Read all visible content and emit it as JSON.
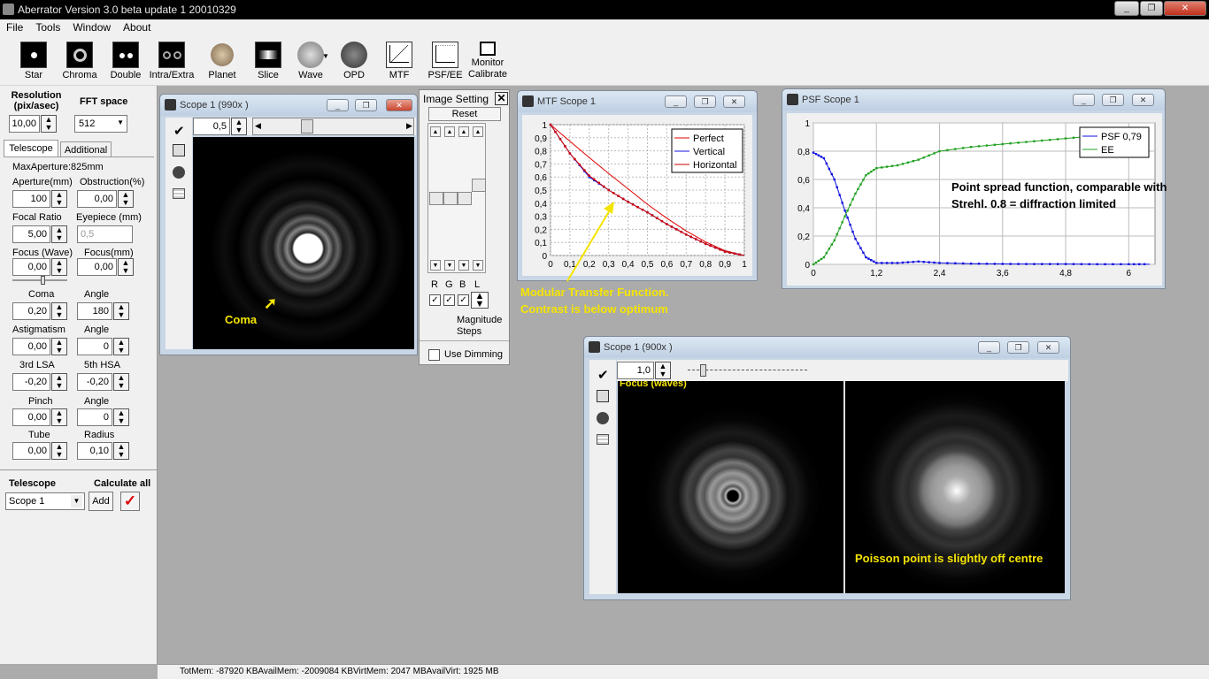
{
  "app": {
    "title": "Aberrator Version 3.0 beta update 1 20010329"
  },
  "menu": [
    "File",
    "Tools",
    "Window",
    "About"
  ],
  "toolbar": [
    "Star",
    "Chroma",
    "Double",
    "Intra/Extra",
    "Planet",
    "Slice",
    "Wave",
    "OPD",
    "MTF",
    "PSF/EE",
    "Monitor Calibrate"
  ],
  "left": {
    "resolution_label": "Resolution (pix/asec)",
    "resolution_value": "10,00",
    "fft_label": "FFT space",
    "fft_value": "512",
    "tab_telescope": "Telescope",
    "tab_additional": "Additional",
    "max_aperture": "MaxAperture:825mm",
    "aperture_label": "Aperture(mm)",
    "aperture_value": "100",
    "obstruction_label": "Obstruction(%)",
    "obstruction_value": "0,00",
    "focal_label": "Focal Ratio",
    "focal_value": "5,00",
    "eyepiece_label": "Eyepiece (mm)",
    "eyepiece_value": "0,5",
    "focuswave_label": "Focus (Wave)",
    "focuswave_value": "0,00",
    "focusmm_label": "Focus(mm)",
    "focusmm_value": "0,00",
    "coma_label": "Coma",
    "coma_value": "0,20",
    "angle1_label": "Angle",
    "angle1_value": "180",
    "astig_label": "Astigmatism",
    "astig_value": "0,00",
    "angle2_label": "Angle",
    "angle2_value": "0",
    "lsa_label": "3rd LSA",
    "lsa_value": "-0,20",
    "hsa_label": "5th HSA",
    "hsa_value": "-0,20",
    "pinch_label": "Pinch",
    "pinch_value": "0,00",
    "angle3_label": "Angle",
    "angle3_value": "0",
    "tube_label": "Tube",
    "tube_value": "0,00",
    "radius_label": "Radius",
    "radius_value": "0,10",
    "telescope_label": "Telescope",
    "calc_label": "Calculate all",
    "scope_select": "Scope 1",
    "add_label": "Add"
  },
  "scope1": {
    "title": "Scope 1 (990x )",
    "value": "0,5",
    "annotation": "Coma"
  },
  "imgset": {
    "title": "Image Setting",
    "reset": "Reset",
    "r": "R",
    "g": "G",
    "b": "B",
    "l": "L",
    "magnitude": "Magnitude Steps",
    "dimming": "Use Dimming"
  },
  "mtf": {
    "title": "MTF Scope 1",
    "annotation": "Modular Transfer Function. Contrast is below optimum"
  },
  "psf": {
    "title": "PSF Scope 1",
    "annotation": "Point spread function, comparable with Strehl. 0.8 = diffraction limited"
  },
  "scope2": {
    "title": "Scope 1 (900x )",
    "value": "1,0",
    "focus_label": "Focus (waves)",
    "annotation": "Poisson point is slightly off centre"
  },
  "status": "TotMem: -87920 KBAvailMem: -2009084 KBVirtMem: 2047 MBAvailVirt: 1925 MB",
  "chart_data": [
    {
      "type": "line",
      "x_ticks": [
        "0",
        "0,1",
        "0,2",
        "0,3",
        "0,4",
        "0,5",
        "0,6",
        "0,7",
        "0,8",
        "0,9",
        "1"
      ],
      "y_ticks": [
        "0",
        "0,1",
        "0,2",
        "0,3",
        "0,4",
        "0,5",
        "0,6",
        "0,7",
        "0,8",
        "0,9",
        "1"
      ],
      "xlim": [
        0,
        1
      ],
      "ylim": [
        0,
        1
      ],
      "grid": true,
      "legend": "top-right",
      "series": [
        {
          "name": "Perfect",
          "color": "#e00000",
          "x": [
            0,
            0.1,
            0.2,
            0.3,
            0.4,
            0.5,
            0.6,
            0.7,
            0.8,
            0.9,
            1.0
          ],
          "y": [
            1.0,
            0.873,
            0.748,
            0.627,
            0.51,
            0.391,
            0.285,
            0.188,
            0.104,
            0.037,
            0.0
          ]
        },
        {
          "name": "Vertical",
          "color": "#1010e0",
          "x": [
            0,
            0.1,
            0.2,
            0.3,
            0.4,
            0.5,
            0.6,
            0.7,
            0.8,
            0.9,
            1.0
          ],
          "y": [
            1.0,
            0.78,
            0.6,
            0.5,
            0.41,
            0.33,
            0.24,
            0.16,
            0.09,
            0.03,
            0.0
          ]
        },
        {
          "name": "Horizontal",
          "color": "#d00000",
          "x": [
            0,
            0.1,
            0.2,
            0.3,
            0.4,
            0.5,
            0.6,
            0.7,
            0.8,
            0.9,
            1.0
          ],
          "y": [
            1.0,
            0.78,
            0.61,
            0.5,
            0.41,
            0.33,
            0.24,
            0.16,
            0.09,
            0.03,
            0.0
          ]
        }
      ]
    },
    {
      "type": "line",
      "x_ticks": [
        "0",
        "1,2",
        "2,4",
        "3,6",
        "4,8",
        "6"
      ],
      "y_ticks": [
        "0",
        "0,2",
        "0,4",
        "0,6",
        "0,8",
        "1"
      ],
      "xlim": [
        0,
        6.5
      ],
      "ylim": [
        0,
        1
      ],
      "grid": true,
      "legend": "top-right",
      "series": [
        {
          "name": "PSF 0,79",
          "color": "#1010e0",
          "x": [
            0,
            0.2,
            0.4,
            0.6,
            0.8,
            1.0,
            1.2,
            1.6,
            2.0,
            2.4,
            3.0,
            3.6,
            4.2,
            4.8,
            5.4,
            6.0,
            6.4
          ],
          "y": [
            0.79,
            0.75,
            0.6,
            0.38,
            0.18,
            0.05,
            0.01,
            0.01,
            0.02,
            0.01,
            0.005,
            0.003,
            0.002,
            0.002,
            0.001,
            0.001,
            0.001
          ]
        },
        {
          "name": "EE",
          "color": "#20a020",
          "x": [
            0,
            0.2,
            0.4,
            0.6,
            0.8,
            1.0,
            1.2,
            1.6,
            2.0,
            2.4,
            3.0,
            3.6,
            4.2,
            4.8,
            5.4,
            6.0
          ],
          "y": [
            0,
            0.05,
            0.17,
            0.34,
            0.5,
            0.63,
            0.68,
            0.7,
            0.74,
            0.8,
            0.83,
            0.85,
            0.87,
            0.89,
            0.91,
            0.93
          ]
        }
      ]
    }
  ]
}
